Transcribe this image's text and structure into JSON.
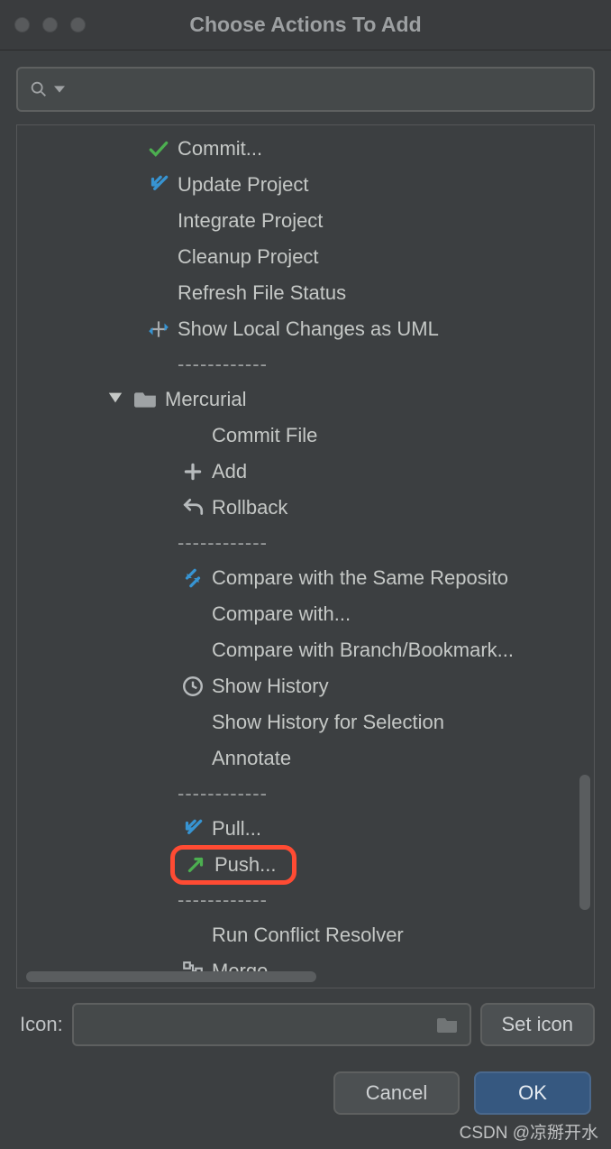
{
  "window": {
    "title": "Choose Actions To Add"
  },
  "search": {
    "placeholder": ""
  },
  "tree": {
    "items": [
      {
        "type": "item",
        "icon": "check-green",
        "label": "Commit..."
      },
      {
        "type": "item",
        "icon": "arrow-down-blue",
        "label": "Update Project"
      },
      {
        "type": "item",
        "icon": "none",
        "label": "Integrate Project"
      },
      {
        "type": "item",
        "icon": "none",
        "label": "Cleanup Project"
      },
      {
        "type": "item",
        "icon": "none",
        "label": "Refresh File Status"
      },
      {
        "type": "item",
        "icon": "uml-diff",
        "label": "Show Local Changes as UML"
      },
      {
        "type": "sep",
        "text": "------------"
      },
      {
        "type": "group",
        "icon": "folder",
        "label": "Mercurial",
        "expanded": true
      },
      {
        "type": "child",
        "icon": "none",
        "label": "Commit File"
      },
      {
        "type": "child",
        "icon": "plus",
        "label": "Add"
      },
      {
        "type": "child",
        "icon": "undo",
        "label": "Rollback"
      },
      {
        "type": "sep",
        "text": "------------"
      },
      {
        "type": "child",
        "icon": "diff-blue",
        "label": "Compare with the Same Reposito"
      },
      {
        "type": "child",
        "icon": "none",
        "label": "Compare with..."
      },
      {
        "type": "child",
        "icon": "none",
        "label": "Compare with Branch/Bookmark..."
      },
      {
        "type": "child",
        "icon": "clock",
        "label": "Show History"
      },
      {
        "type": "child",
        "icon": "none",
        "label": "Show History for Selection"
      },
      {
        "type": "child",
        "icon": "none",
        "label": "Annotate"
      },
      {
        "type": "sep",
        "text": "------------"
      },
      {
        "type": "child",
        "icon": "arrow-down-blue",
        "label": "Pull..."
      },
      {
        "type": "child",
        "icon": "arrow-up-green",
        "label": "Push...",
        "highlight": true
      },
      {
        "type": "sep",
        "text": "------------"
      },
      {
        "type": "child",
        "icon": "none",
        "label": "Run Conflict Resolver"
      },
      {
        "type": "child",
        "icon": "merge",
        "label": "Merge..."
      }
    ]
  },
  "footer": {
    "icon_label": "Icon:",
    "set_icon": "Set icon",
    "cancel": "Cancel",
    "ok": "OK"
  },
  "watermark": "CSDN @凉掰开水"
}
